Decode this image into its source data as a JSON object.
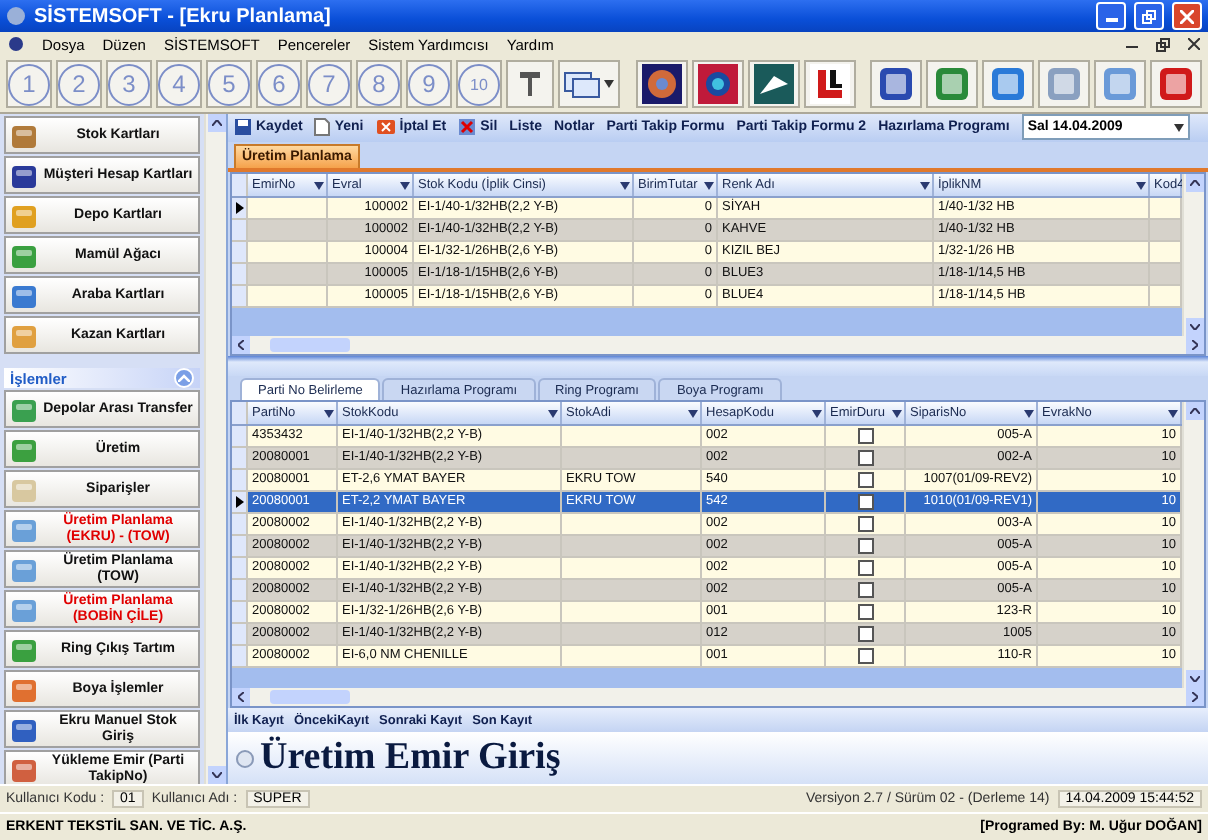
{
  "window": {
    "title": "SİSTEMSOFT  - [Ekru Planlama]"
  },
  "menu": [
    "Dosya",
    "Düzen",
    "SİSTEMSOFT",
    "Pencereler",
    "Sistem Yardımcısı",
    "Yardım"
  ],
  "toolbar": {
    "number_buttons": [
      "1",
      "2",
      "3",
      "4",
      "5",
      "6",
      "7",
      "8",
      "9",
      "10"
    ]
  },
  "sidebar": {
    "items": [
      {
        "label": "Stok Kartları",
        "highlighted": false
      },
      {
        "label": "Müşteri Hesap Kartları",
        "highlighted": false
      },
      {
        "label": "Depo Kartları",
        "highlighted": false
      },
      {
        "label": "Mamül Ağacı",
        "highlighted": false
      },
      {
        "label": "Araba Kartları",
        "highlighted": false
      },
      {
        "label": "Kazan Kartları",
        "highlighted": false
      }
    ],
    "section": {
      "title": "İşlemler",
      "expanded": true,
      "items": [
        {
          "label": "Depolar Arası Transfer",
          "highlighted": false
        },
        {
          "label": "Üretim",
          "highlighted": false
        },
        {
          "label": "Siparişler",
          "highlighted": false
        },
        {
          "label": "Üretim Planlama (EKRU) - (TOW)",
          "highlighted": true
        },
        {
          "label": "Üretim Planlama (TOW)",
          "highlighted": false
        },
        {
          "label": "Üretim Planlama (BOBİN ÇİLE)",
          "highlighted": true
        },
        {
          "label": "Ring Çıkış Tartım",
          "highlighted": false
        },
        {
          "label": "Boya İşlemler",
          "highlighted": false
        },
        {
          "label": "Ekru Manuel Stok Giriş",
          "highlighted": false
        },
        {
          "label": "Yükleme Emir (Parti TakipNo)",
          "highlighted": false
        }
      ]
    }
  },
  "form": {
    "toolbar": [
      {
        "label": "Kaydet",
        "kind": "icon"
      },
      {
        "label": "Yeni",
        "kind": "icon"
      },
      {
        "label": "İptal Et",
        "kind": "icon"
      },
      {
        "label": "Sil",
        "kind": "icon"
      },
      {
        "label": "Liste",
        "kind": "text"
      },
      {
        "label": "Notlar",
        "kind": "text"
      },
      {
        "label": "Parti Takip Formu",
        "kind": "text"
      },
      {
        "label": "Parti Takip Formu 2",
        "kind": "text"
      },
      {
        "label": "Hazırlama Programı",
        "kind": "text"
      }
    ],
    "date_field": {
      "value": "Sal 14.04.2009"
    },
    "tabs": [
      {
        "label": "Üretim Planlama",
        "selected": true
      }
    ],
    "top_grid": {
      "columns": [
        "EmirNo",
        "Evral",
        "Stok Kodu (İplik Cinsi)",
        "BirimTutar",
        "Renk Adı",
        "İplikNM",
        "Kod4"
      ],
      "rows": [
        {
          "current": true,
          "cells": [
            "",
            "100002",
            "EI-1/40-1/32HB(2,2 Y-B)",
            "0",
            "SİYAH",
            "1/40-1/32 HB",
            ""
          ]
        },
        {
          "current": false,
          "cells": [
            "",
            "100002",
            "EI-1/40-1/32HB(2,2 Y-B)",
            "0",
            "KAHVE",
            "1/40-1/32 HB",
            ""
          ]
        },
        {
          "current": false,
          "cells": [
            "",
            "100004",
            "EI-1/32-1/26HB(2,6 Y-B)",
            "0",
            "KIZIL BEJ",
            "1/32-1/26 HB",
            ""
          ]
        },
        {
          "current": false,
          "cells": [
            "",
            "100005",
            "EI-1/18-1/15HB(2,6 Y-B)",
            "0",
            "BLUE3",
            "1/18-1/14,5 HB",
            ""
          ]
        },
        {
          "current": false,
          "cells": [
            "",
            "100005",
            "EI-1/18-1/15HB(2,6 Y-B)",
            "0",
            "BLUE4",
            "1/18-1/14,5 HB",
            ""
          ]
        }
      ]
    },
    "detail_tabs": [
      {
        "label": "Parti No Belirleme",
        "selected": true
      },
      {
        "label": "Hazırlama Programı",
        "selected": false
      },
      {
        "label": "Ring Programı",
        "selected": false
      },
      {
        "label": "Boya Programı",
        "selected": false
      }
    ],
    "bottom_grid": {
      "columns": [
        "PartiNo",
        "StokKodu",
        "StokAdi",
        "HesapKodu",
        "EmirDuru",
        "SiparisNo",
        "EvrakNo"
      ],
      "rows": [
        {
          "selected": false,
          "cells": [
            "4353432",
            "EI-1/40-1/32HB(2,2 Y-B)",
            "",
            "002",
            "005-A",
            "10"
          ],
          "emir_durumu": false
        },
        {
          "selected": false,
          "cells": [
            "20080001",
            "EI-1/40-1/32HB(2,2 Y-B)",
            "",
            "002",
            "002-A",
            "10"
          ],
          "emir_durumu": false
        },
        {
          "selected": false,
          "cells": [
            "20080001",
            "ET-2,6 YMAT BAYER",
            "EKRU TOW",
            "540",
            "1007(01/09-REV2)",
            "10"
          ],
          "emir_durumu": false
        },
        {
          "selected": true,
          "cells": [
            "20080001",
            "ET-2,2 YMAT BAYER",
            "EKRU TOW",
            "542",
            "1010(01/09-REV1)",
            "10"
          ],
          "emir_durumu": false
        },
        {
          "selected": false,
          "cells": [
            "20080002",
            "EI-1/40-1/32HB(2,2 Y-B)",
            "",
            "002",
            "003-A",
            "10"
          ],
          "emir_durumu": false
        },
        {
          "selected": false,
          "cells": [
            "20080002",
            "EI-1/40-1/32HB(2,2 Y-B)",
            "",
            "002",
            "005-A",
            "10"
          ],
          "emir_durumu": false
        },
        {
          "selected": false,
          "cells": [
            "20080002",
            "EI-1/40-1/32HB(2,2 Y-B)",
            "",
            "002",
            "005-A",
            "10"
          ],
          "emir_durumu": false
        },
        {
          "selected": false,
          "cells": [
            "20080002",
            "EI-1/40-1/32HB(2,2 Y-B)",
            "",
            "002",
            "005-A",
            "10"
          ],
          "emir_durumu": false
        },
        {
          "selected": false,
          "cells": [
            "20080002",
            "EI-1/32-1/26HB(2,6 Y-B)",
            "",
            "001",
            "123-R",
            "10"
          ],
          "emir_durumu": false
        },
        {
          "selected": false,
          "cells": [
            "20080002",
            "EI-1/40-1/32HB(2,2 Y-B)",
            "",
            "012",
            "1005",
            "10"
          ],
          "emir_durumu": false
        },
        {
          "selected": false,
          "cells": [
            "20080002",
            "EI-6,0 NM CHENILLE",
            "",
            "001",
            "110-R",
            "10"
          ],
          "emir_durumu": false
        }
      ]
    },
    "navigation": [
      "İlk Kayıt",
      "ÖncekiKayıt",
      "Sonraki Kayıt",
      "Son Kayıt"
    ],
    "heading": "Üretim Emir Giriş"
  },
  "status_bar": {
    "user_code_label": "Kullanıcı Kodu :",
    "user_code": "01",
    "user_name_label": "Kullanıcı Adı :",
    "user_name": "SUPER",
    "version": "Versiyon 2.7 / Sürüm 02 - (Derleme 14)",
    "datetime": "14.04.2009 15:44:52",
    "company": "ERKENT TEKSTİL SAN. VE TİC. A.Ş.",
    "credit": "[Programed By: M. Uğur DOĞAN]"
  }
}
